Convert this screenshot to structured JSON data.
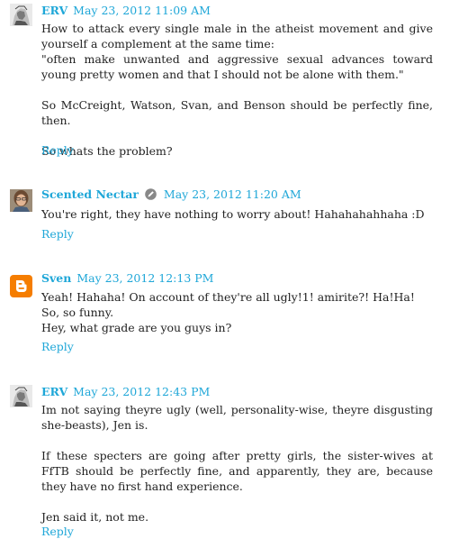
{
  "comments": [
    {
      "author": "ERV",
      "timestamp": "May 23, 2012 11:09 AM",
      "paragraphs": [
        [
          "How to attack every single male in the atheist movement and give yourself a complement at the same time:",
          "\"often make unwanted and aggressive sexual advances toward young pretty women and that I should not be alone with them.\""
        ],
        [
          "So McCreight, Watson, Svan, and Benson should be perfectly fine, then."
        ],
        [
          "So whats the problem?"
        ]
      ],
      "reply": "Reply",
      "avatar_icon": "sketch-avatar-icon"
    },
    {
      "author": "Scented Nectar",
      "timestamp": "May 23, 2012 11:20 AM",
      "paragraphs": [
        [
          "You're right, they have nothing to worry about! Hahahahahhaha :D"
        ]
      ],
      "reply": "Reply",
      "avatar_icon": "photo-avatar-icon",
      "badge_icon": "pencil-icon"
    },
    {
      "author": "Sven",
      "timestamp": "May 23, 2012 12:13 PM",
      "paragraphs": [
        [
          "Yeah! Hahaha! On account of they're all ugly!1! amirite?! Ha!Ha!",
          "So, so funny.",
          "Hey, what grade are you guys in?"
        ]
      ],
      "reply": "Reply",
      "avatar_icon": "blogger-logo-icon"
    },
    {
      "author": "ERV",
      "timestamp": "May 23, 2012 12:43 PM",
      "paragraphs": [
        [
          "Im not saying theyre ugly (well, personality-wise, theyre disgusting she-beasts), Jen is."
        ],
        [
          "If these specters are going after pretty girls, the sister-wives at FfTB should be perfectly fine, and apparently, they are, because they have no first hand experience."
        ],
        [
          "Jen said it, not me."
        ]
      ],
      "reply": "Reply",
      "avatar_icon": "sketch-avatar-icon"
    }
  ],
  "colors": {
    "link": "#1fa7d8",
    "text": "#222222",
    "blogger": "#f57d00"
  }
}
